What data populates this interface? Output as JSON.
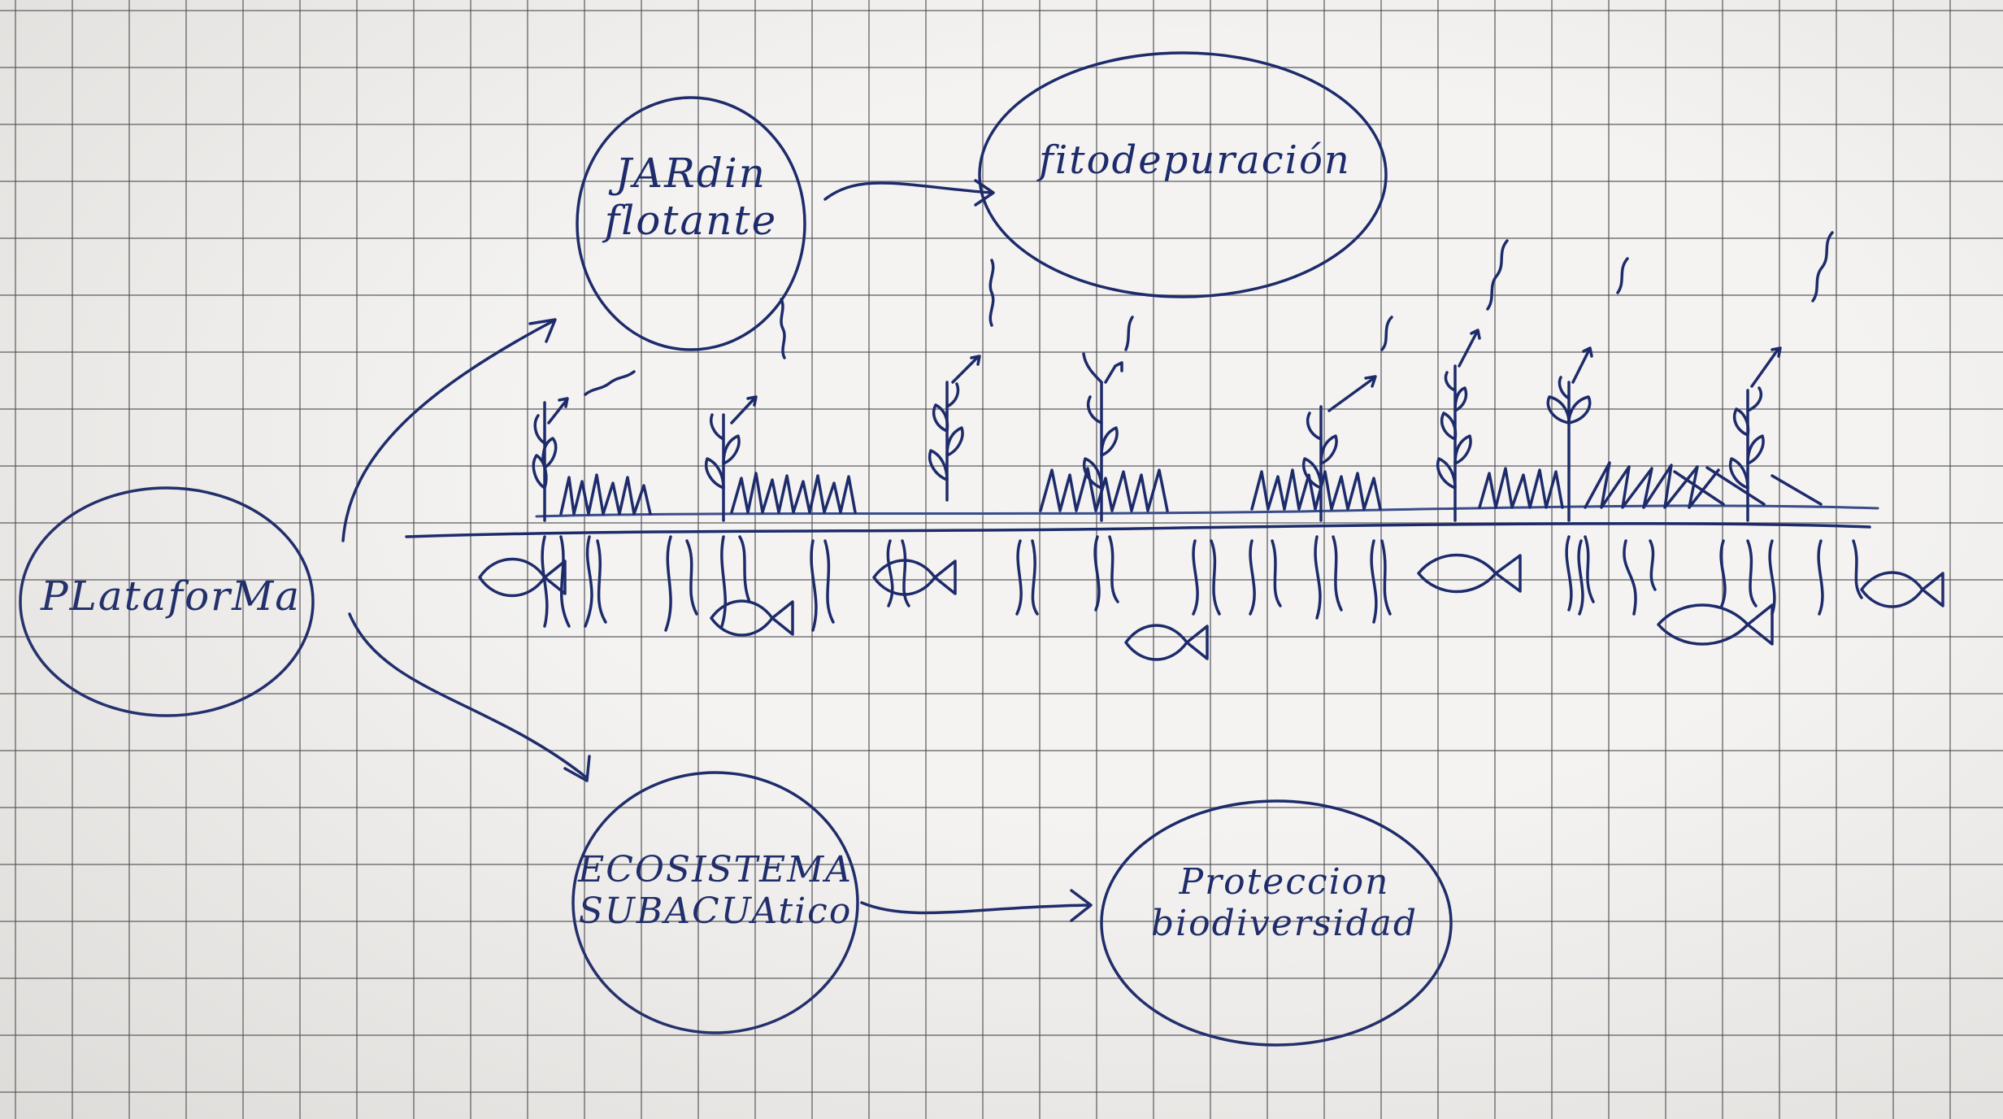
{
  "nodes": {
    "plataforma": "PLataforMa",
    "jardin_line1": "JARdin",
    "jardin_line2": "flotante",
    "fitodepuracion": "fitodepuración",
    "ecosistema_line1": "ECOSISTEMA",
    "ecosistema_line2": "SUBACUAtico",
    "proteccion_line1": "Proteccion",
    "proteccion_line2": "biodiversidad"
  },
  "colors": {
    "ink": "#1d2b6b",
    "paper": "#f4f3f1",
    "grid": "#46464b"
  }
}
